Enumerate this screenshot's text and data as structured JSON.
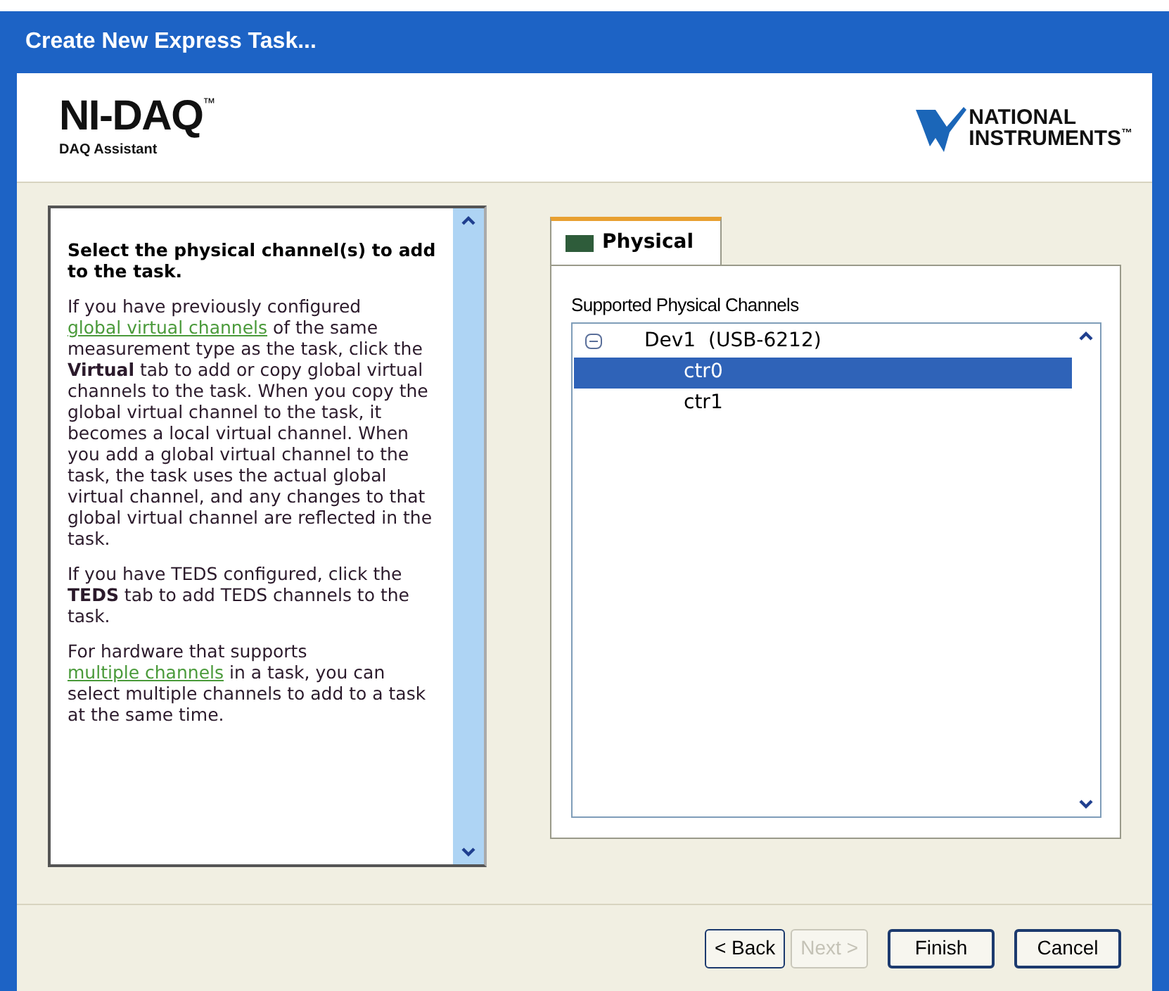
{
  "window": {
    "title": "Create New Express Task..."
  },
  "header": {
    "product": "NI-DAQ",
    "trademark": "™",
    "subtitle": "DAQ Assistant",
    "logo_line_1": "NATIONAL",
    "logo_line_2": "INSTRUMENTS",
    "logo_mark": "™"
  },
  "help": {
    "heading": "Select the physical channel(s) to add to the task.",
    "paragraphs": [
      [
        {
          "kind": "text",
          "text": "If you have previously configured "
        },
        {
          "kind": "link",
          "text": "global virtual channels"
        },
        {
          "kind": "text",
          "text": " of the same measurement type as the task, click the **Virtual** tab to add or copy global virtual channels to the task. When you copy the global virtual channel to the task, it becomes a local virtual channel. When you add a global virtual channel to the task, the task uses the actual global virtual channel, and any changes to that global virtual channel are reflected in the task."
        }
      ],
      [
        {
          "kind": "text",
          "text": "If you have TEDS configured, click the **TEDS** tab to add TEDS channels to the task."
        }
      ],
      [
        {
          "kind": "text",
          "text": "For hardware that supports "
        },
        {
          "kind": "link",
          "text": "multiple channels"
        },
        {
          "kind": "text",
          "text": " in a task, you can select multiple channels to add to a task at the same time."
        }
      ]
    ]
  },
  "tabs": [
    {
      "label": "Physical",
      "selected": true
    }
  ],
  "channels": {
    "label": "Supported Physical Channels",
    "tree": [
      {
        "label": "Dev1  (USB-6212)",
        "expanded": true,
        "selected": false,
        "children": [
          {
            "label": "ctr0",
            "selected": true
          },
          {
            "label": "ctr1",
            "selected": false
          }
        ]
      }
    ]
  },
  "buttons": [
    {
      "label": "< Back",
      "disabled": false
    },
    {
      "label": "Next >",
      "disabled": true
    },
    {
      "label": "Finish",
      "disabled": false
    },
    {
      "label": "Cancel",
      "disabled": false
    }
  ]
}
